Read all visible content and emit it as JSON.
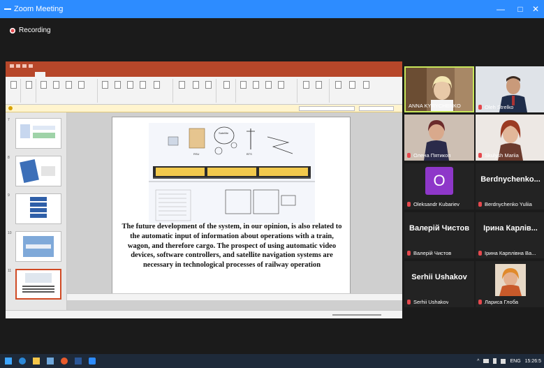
{
  "window": {
    "title": "Zoom Meeting",
    "controls": [
      "—",
      "□",
      "✕"
    ]
  },
  "recording": {
    "label": "Recording"
  },
  "shared_screen": {
    "slide_text": "The future development of the system, in our opinion, is also related to the automatic input of information about operations with a train, wagon, and therefore cargo. The prospect of using automatic video devices, software controllers, and satellite navigation systems are necessary in technological processes of railway operation",
    "thumb_numbers": [
      "7",
      "8",
      "9",
      "10",
      "11"
    ],
    "diagram_labels": {
      "sat1": "Satellite",
      "rsu": "RSU",
      "bts": "BTS"
    }
  },
  "participants": [
    {
      "name": "ANNA KYRYCHENKO",
      "kind": "video",
      "active": true,
      "muted": false
    },
    {
      "name": "Oleh Strelko",
      "kind": "video",
      "active": false,
      "muted": true
    },
    {
      "name": "Олена Пятикоп",
      "kind": "video",
      "active": false,
      "muted": true
    },
    {
      "name": "Skulysh Mariia",
      "kind": "video",
      "active": false,
      "muted": true
    },
    {
      "name": "Oleksandr Kubariev",
      "kind": "avatar",
      "initial": "O",
      "active": false,
      "muted": true
    },
    {
      "name": "Berdnychenko Yuliia",
      "kind": "text",
      "big": "Berdnychenko...",
      "active": false,
      "muted": true
    },
    {
      "name": "Валерій Чистов",
      "kind": "text",
      "big": "Валерій Чистов",
      "active": false,
      "muted": true
    },
    {
      "name": "Ірина Карплівна Ва...",
      "kind": "text",
      "big": "Ірина Карлів...",
      "active": false,
      "muted": true
    },
    {
      "name": "Serhii Ushakov",
      "kind": "text",
      "big": "Serhii Ushakov",
      "active": false,
      "muted": true
    },
    {
      "name": "Лариса Глоба",
      "kind": "video",
      "active": false,
      "muted": true
    }
  ],
  "taskbar": {
    "language": "ENG",
    "time": "15:26:5",
    "tray_arrow": "^"
  },
  "colors": {
    "zoom_blue": "#2d8cff",
    "powerpoint_red": "#b7472a",
    "active_speaker": "#c8e65a",
    "muted_red": "#e5484d",
    "avatar_purple": "#8e37c9"
  }
}
